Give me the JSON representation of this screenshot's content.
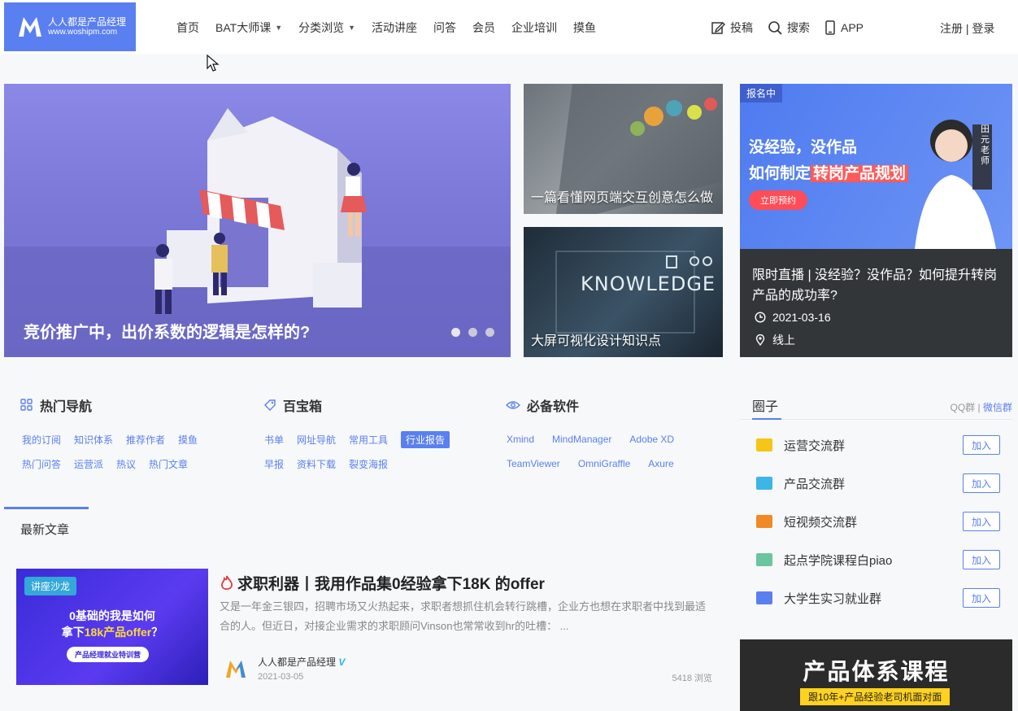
{
  "colors": {
    "accent": "#5a7ff0",
    "logo_bg": "#5a7ff0",
    "dark": "#333639"
  },
  "logo": {
    "name": "人人都是产品经理",
    "domain": "www.woshipm.com"
  },
  "nav": {
    "items": [
      {
        "label": "首页"
      },
      {
        "label": "BAT大师课",
        "dropdown": true
      },
      {
        "label": "分类浏览",
        "dropdown": true
      },
      {
        "label": "活动讲座"
      },
      {
        "label": "问答"
      },
      {
        "label": "会员"
      },
      {
        "label": "企业培训"
      },
      {
        "label": "摸鱼"
      }
    ],
    "tools": [
      {
        "label": "投稿",
        "icon": "edit-icon"
      },
      {
        "label": "搜索",
        "icon": "search-icon"
      },
      {
        "label": "APP",
        "icon": "phone-icon"
      }
    ],
    "auth": "注册 | 登录"
  },
  "hero": {
    "title": "竞价推广中，出价系数的逻辑是怎样的?"
  },
  "cards": [
    {
      "caption": "一篇看懂网页端交互创意怎么做"
    },
    {
      "caption": "大屏可视化设计知识点",
      "image_text": "KNOWLEDGE"
    }
  ],
  "promo": {
    "badge": "报名中",
    "headline1": "没经验，没作品",
    "headline2_prefix": "如何制定",
    "headline2_highlight": "转岗产品规划",
    "cta": "立即预约",
    "title": "限时直播 | 没经验？没作品？如何提升转岗产品的成功率?",
    "date": "2021-03-16",
    "place": "线上",
    "teacher": "田元老师"
  },
  "sections": {
    "hot_nav": {
      "title": "热门导航",
      "rows": [
        [
          "我的订阅",
          "知识体系",
          "推荐作者",
          "摸鱼"
        ],
        [
          "热门问答",
          "运营派",
          "热议",
          "热门文章"
        ]
      ]
    },
    "treasure": {
      "title": "百宝箱",
      "rows": [
        [
          "书单",
          "网址导航",
          "常用工具",
          "行业报告"
        ],
        [
          "早报",
          "资料下载",
          "裂变海报"
        ]
      ],
      "active": "行业报告"
    },
    "software": {
      "title": "必备软件",
      "rows": [
        [
          "Xmind",
          "MindManager",
          "Adobe XD"
        ],
        [
          "TeamViewer",
          "OmniGraffle",
          "Axure"
        ]
      ]
    }
  },
  "latest": {
    "label": "最新文章",
    "article": {
      "tag": "讲座沙龙",
      "thumb_line1": "0基础的我是如何",
      "thumb_line2_prefix": "拿下",
      "thumb_line2_highlight": "18k产品offer",
      "thumb_line2_suffix": "？",
      "thumb_pill": "产品经理就业特训营",
      "title": "求职利器丨我用作品集0经验拿下18K 的offer",
      "description": "又是一年金三银四，招聘市场又火热起来，求职者想抓住机会转行跳槽，企业方也想在求职者中找到最适合的人。但近日，对接企业需求的求职顾问Vinson也常常收到hr的吐槽： ...",
      "author": "人人都是产品经理",
      "date": "2021-03-05",
      "views": "5418 浏览"
    }
  },
  "sidebar": {
    "title": "圈子",
    "qq": "QQ群",
    "sep": " | ",
    "wechat": "微信群",
    "join_label": "加入",
    "groups": [
      {
        "name": "运营交流群",
        "color": "#f5c518"
      },
      {
        "name": "产品交流群",
        "color": "#3db5e6"
      },
      {
        "name": "短视频交流群",
        "color": "#f08a24"
      },
      {
        "name": "起点学院课程白piao",
        "color": "#6cc5a0"
      },
      {
        "name": "大学生实习就业群",
        "color": "#5a7ff0"
      }
    ],
    "course": {
      "title": "产品体系课程",
      "subtitle": "跟10年+产品经验老司机面对面"
    }
  }
}
